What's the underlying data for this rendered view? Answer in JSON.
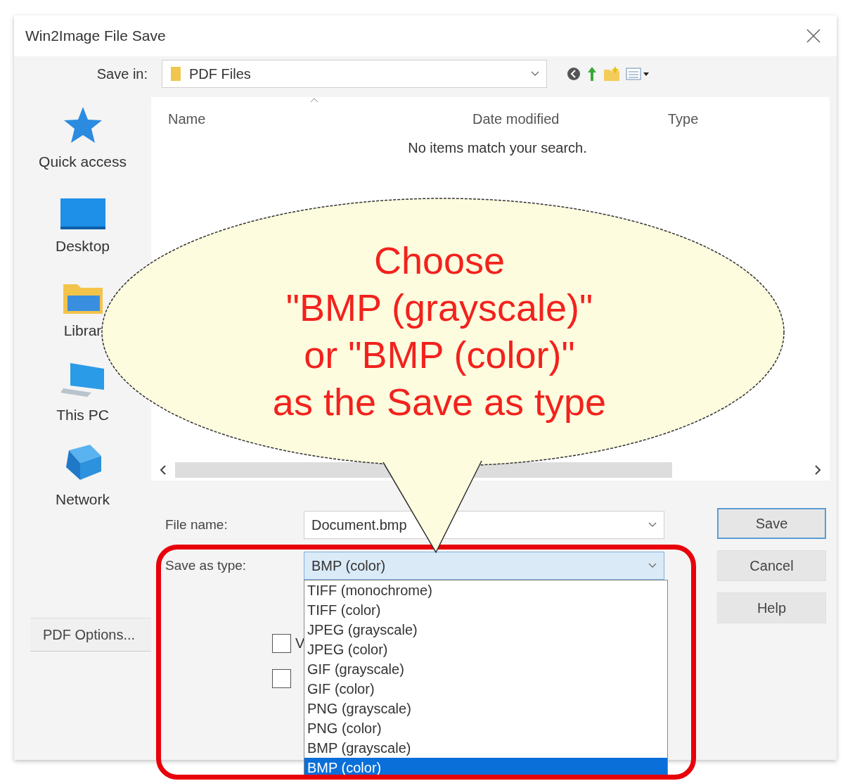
{
  "window": {
    "title": "Win2Image File Save"
  },
  "save_in": {
    "label": "Save in:",
    "value": "PDF Files"
  },
  "places": [
    {
      "label": "Quick access",
      "kind": "star"
    },
    {
      "label": "Desktop",
      "kind": "desktop"
    },
    {
      "label": "Librar",
      "kind": "library"
    },
    {
      "label": "This PC",
      "kind": "computer"
    },
    {
      "label": "Network",
      "kind": "network"
    }
  ],
  "file_list": {
    "columns": [
      "Name",
      "Date modified",
      "Type"
    ],
    "empty_message": "No items match your search."
  },
  "file_name": {
    "label": "File name:",
    "value": "Document.bmp"
  },
  "save_as_type": {
    "label": "Save as type:",
    "value": "BMP (color)",
    "expanded": true,
    "options": [
      {
        "label": "TIFF (monochrome)",
        "selected": false
      },
      {
        "label": "TIFF (color)",
        "selected": false
      },
      {
        "label": "JPEG (grayscale)",
        "selected": false
      },
      {
        "label": "JPEG (color)",
        "selected": false
      },
      {
        "label": "GIF (grayscale)",
        "selected": false
      },
      {
        "label": "GIF (color)",
        "selected": false
      },
      {
        "label": "PNG (grayscale)",
        "selected": false
      },
      {
        "label": "PNG (color)",
        "selected": false
      },
      {
        "label": "BMP (grayscale)",
        "selected": false
      },
      {
        "label": "BMP (color)",
        "selected": true
      }
    ]
  },
  "checkboxes": [
    {
      "label": "V",
      "checked": false
    },
    {
      "checked": false
    }
  ],
  "buttons": [
    {
      "label": "Save",
      "default": true
    },
    {
      "label": "Cancel",
      "default": false
    },
    {
      "label": "Help",
      "default": false
    }
  ],
  "pdf_options_button": "PDF Options...",
  "callout": {
    "text": "Choose\n\"BMP (grayscale)\"\nor \"BMP (color)\"\nas the Save as type"
  }
}
